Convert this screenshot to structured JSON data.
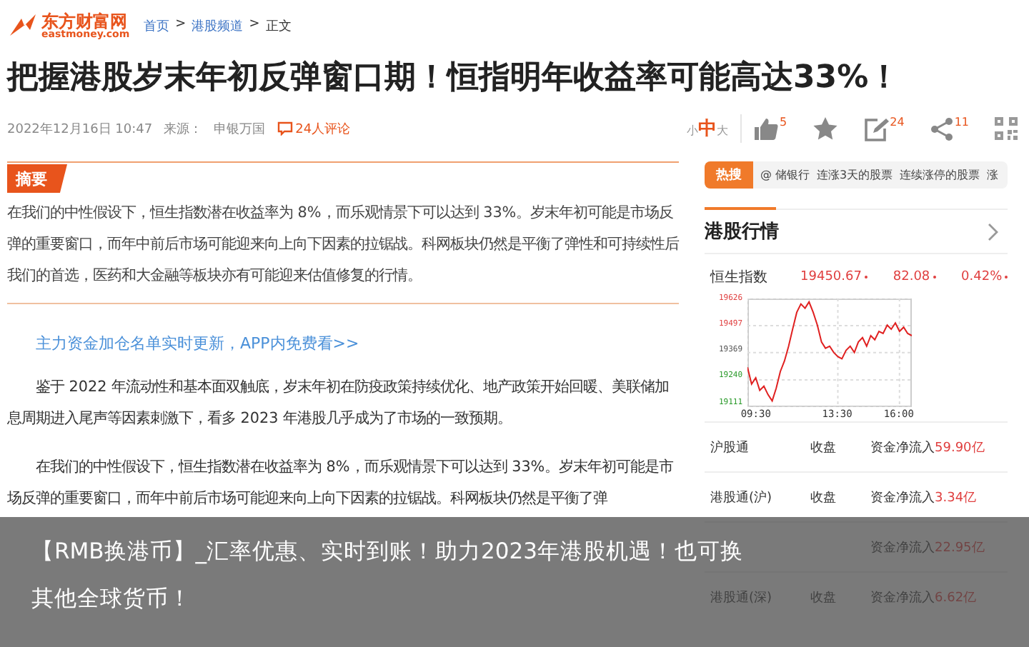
{
  "header": {
    "logo_cn": "东方财富网",
    "logo_en": "eastmoney.com",
    "breadcrumb": [
      {
        "label": "首页",
        "kind": "link"
      },
      {
        "label": ">",
        "kind": "separator"
      },
      {
        "label": "港股频道",
        "kind": "link"
      },
      {
        "label": ">",
        "kind": "separator"
      },
      {
        "label": "正文",
        "kind": "current"
      }
    ]
  },
  "article": {
    "title": "把握港股岁末年初反弹窗口期！恒指明年收益率可能高达33%！",
    "date": "2022年12月16日 10:47",
    "source_label": "来源：",
    "source": "申银万国",
    "comments": "24人评论",
    "font_sizes": [
      {
        "label": "小",
        "selected": false
      },
      {
        "label": "中",
        "selected": true
      },
      {
        "label": "大",
        "selected": false
      }
    ],
    "actions": [
      {
        "kind": "like",
        "count": "5"
      },
      {
        "kind": "star"
      },
      {
        "kind": "edit",
        "count": "24"
      },
      {
        "kind": "share",
        "count": "11"
      },
      {
        "kind": "qr"
      }
    ],
    "summary_label": "摘要",
    "summary": "在我们的中性假设下，恒生指数潜在收益率为 8%，而乐观情景下可以达到 33%。岁末年初可能是市场反弹的重要窗口，而年中前后市场可能迎来向上向下因素的拉锯战。科网板块仍然是平衡了弹性和可持续性后我们的首选，医药和大金融等板块亦有可能迎来估值修复的行情。",
    "promo_link": "主力资金加仓名单实时更新，APP内免费看>>",
    "paragraphs": [
      "鉴于 2022 年流动性和基本面双触底，岁末年初在防疫政策持续优化、地产政策开始回暖、美联储加息周期进入尾声等因素刺激下，看多 2023 年港股几乎成为了市场的一致预期。",
      "在我们的中性假设下，恒生指数潜在收益率为 8%，而乐观情景下可以达到 33%。岁末年初可能是市场反弹的重要窗口，而年中前后市场可能迎来向上向下因素的拉锯战。科网板块仍然是平衡了弹"
    ]
  },
  "sidebar": {
    "hot_label": "热搜",
    "hot_items": [
      "@ 储银行",
      "连涨3天的股票",
      "连续涨停的股票",
      "涨"
    ],
    "market_title": "港股行情",
    "index": {
      "name": "恒生指数",
      "price": "19450.67",
      "change": "82.08",
      "percent": "0.42%"
    },
    "chart_data": {
      "type": "line",
      "grid": true,
      "categories": [
        "09:30",
        null,
        null,
        null,
        null,
        null,
        null,
        null,
        null,
        null,
        null,
        null,
        null,
        null,
        null,
        null,
        null,
        null,
        null,
        null,
        null,
        null,
        "13:30",
        null,
        null,
        null,
        null,
        null,
        null,
        null,
        null,
        null,
        null,
        null,
        null,
        null,
        null,
        "16:00",
        null,
        null,
        null
      ],
      "yticks": [
        19111,
        19240,
        19369,
        19497,
        19626
      ],
      "ylim": [
        19111,
        19626
      ],
      "series": [
        {
          "color": "#e02020",
          "values": [
            19300,
            19220,
            19250,
            19190,
            19210,
            19170,
            19140,
            19200,
            19280,
            19330,
            19400,
            19480,
            19560,
            19600,
            19580,
            19610,
            19560,
            19500,
            19420,
            19390,
            19400,
            19370,
            19350,
            19340,
            19380,
            19400,
            19370,
            19420,
            19440,
            19400,
            19450,
            19430,
            19470,
            19460,
            19500,
            19480,
            19510,
            19470,
            19490,
            19460,
            19450
          ]
        }
      ]
    },
    "flows": [
      {
        "name": "沪股通",
        "status": "收盘",
        "label": "资金净流入",
        "value": "59.90亿"
      },
      {
        "name": "港股通(沪)",
        "status": "收盘",
        "label": "资金净流入",
        "value": "3.34亿"
      },
      {
        "label": "资金净流入",
        "value": "22.95亿"
      },
      {
        "name": "港股通(深)",
        "status": "收盘",
        "label": "资金净流入",
        "value": "6.62亿"
      }
    ]
  },
  "ad_caption": [
    "【RMB换港币】_汇率优惠、实时到账！助力2023年港股机遇！也可换",
    "其他全球货币！"
  ]
}
